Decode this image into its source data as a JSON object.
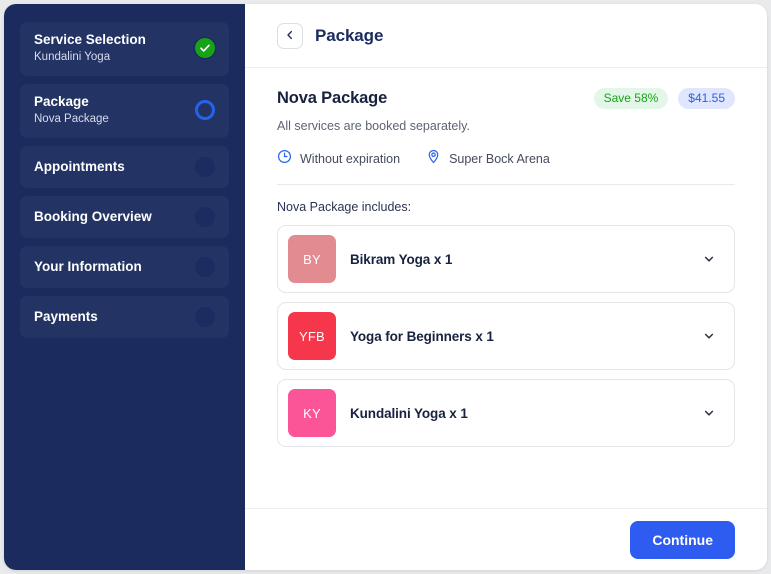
{
  "sidebar": {
    "steps": [
      {
        "title": "Service Selection",
        "sub": "Kundalini Yoga",
        "state": "done"
      },
      {
        "title": "Package",
        "sub": "Nova Package",
        "state": "active"
      },
      {
        "title": "Appointments",
        "sub": "",
        "state": "todo"
      },
      {
        "title": "Booking Overview",
        "sub": "",
        "state": "todo"
      },
      {
        "title": "Your Information",
        "sub": "",
        "state": "todo"
      },
      {
        "title": "Payments",
        "sub": "",
        "state": "todo"
      }
    ]
  },
  "header": {
    "title": "Package",
    "back_icon": "chevron-left-icon"
  },
  "package": {
    "name": "Nova Package",
    "save_badge": "Save 58%",
    "price_badge": "$41.55",
    "description": "All services are booked separately.",
    "expiration_label": "Without expiration",
    "expiration_icon": "clock-icon",
    "location_label": "Super Bock Arena",
    "location_icon": "map-pin-icon",
    "includes_label": "Nova Package includes:",
    "services": [
      {
        "initials": "BY",
        "name": "Bikram Yoga x 1",
        "color": "#e28b90"
      },
      {
        "initials": "YFB",
        "name": "Yoga for Beginners x 1",
        "color": "#f6374b"
      },
      {
        "initials": "KY",
        "name": "Kundalini Yoga x 1",
        "color": "#fb5497"
      }
    ]
  },
  "footer": {
    "continue_label": "Continue"
  },
  "colors": {
    "sidebar_bg": "#1b2b5e",
    "step_bg": "#223364",
    "accent_blue": "#2563eb",
    "button_blue": "#2f5cf0",
    "success_green": "#17a217"
  }
}
